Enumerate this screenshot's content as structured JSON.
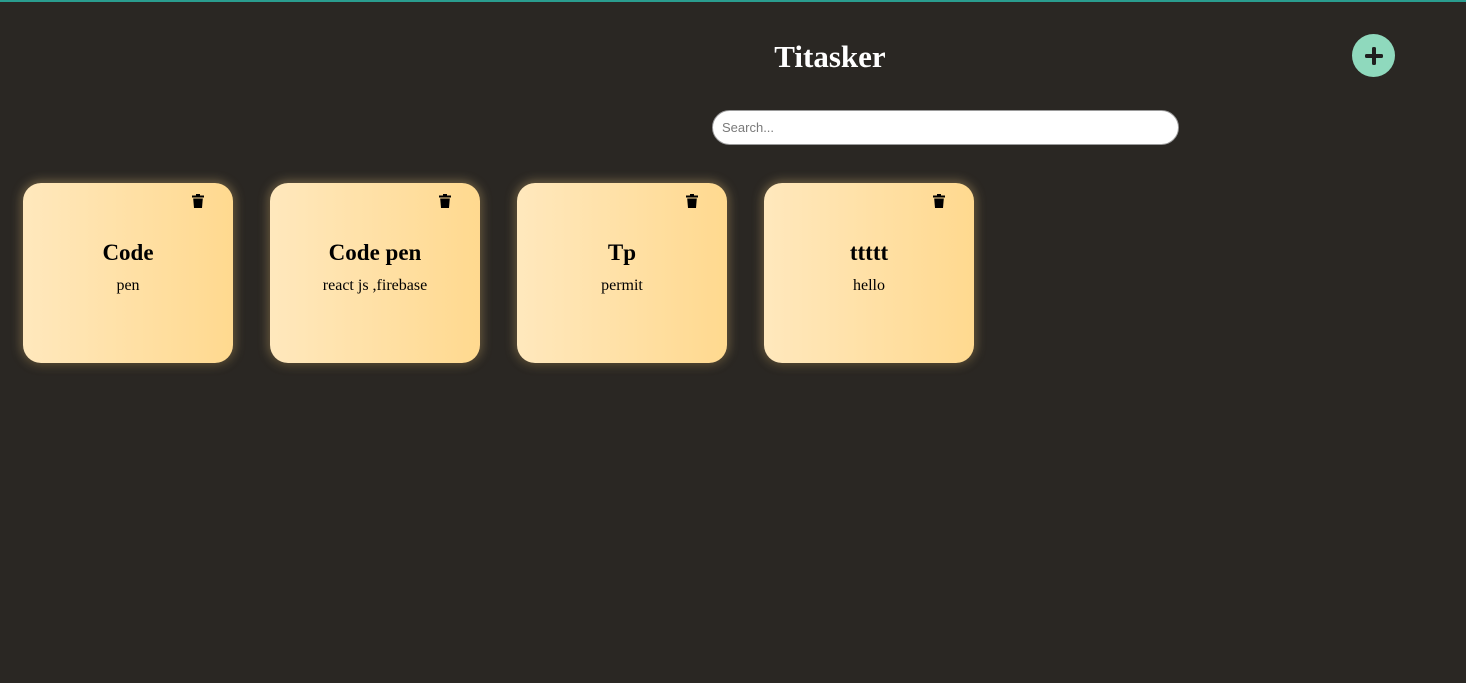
{
  "header": {
    "title": "Titasker",
    "add_icon": "plus-icon",
    "add_color": "#8fd9bd"
  },
  "search": {
    "placeholder": "Search...",
    "value": ""
  },
  "colors": {
    "background": "#2a2723",
    "card_gradient_start": "#ffe8bd",
    "card_gradient_end": "#ffd98f",
    "top_border": "#2a9d8f"
  },
  "cards": [
    {
      "title": "Code",
      "description": "pen",
      "delete_icon": "trash-icon"
    },
    {
      "title": "Code pen",
      "description": "react js ,firebase",
      "delete_icon": "trash-icon"
    },
    {
      "title": "Tp",
      "description": "permit",
      "delete_icon": "trash-icon"
    },
    {
      "title": "ttttt",
      "description": "hello",
      "delete_icon": "trash-icon"
    }
  ]
}
